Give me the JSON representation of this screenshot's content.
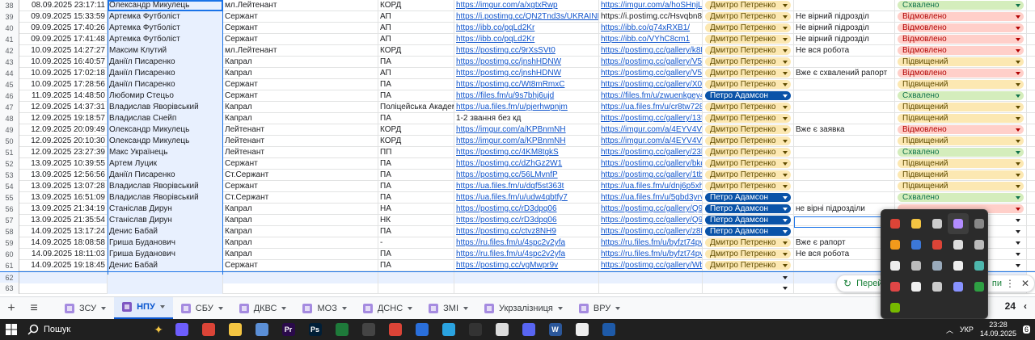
{
  "rows": [
    {
      "num": "38",
      "date": "08.09.2025 23:17:11",
      "name": "Олександр Микулець",
      "rank": "мл.Лейтенант",
      "unit": "КОРД",
      "link1": "https://imgur.com/a/xgtxRwp",
      "link2": "https://imgur.com/a/hoSHnjL",
      "reviewer": "Дмитро Петренко",
      "reviewer_style": "yellow",
      "note": "",
      "status": "Схвалено",
      "status_style": "green"
    },
    {
      "num": "39",
      "date": "09.09.2025 15:33:59",
      "name": "Артемка Футболіст",
      "rank": "Сержант",
      "unit": "АП",
      "link1": "https://i.postimg.cc/QN2Tnd3s/UKRAINE-GT",
      "link2": "https://i.postimg.cc/Hsvqbn80/U",
      "reviewer": "Дмитро Петренко",
      "reviewer_style": "yellow",
      "note": "Не вірний підрозділ",
      "status": "Відмовлено",
      "status_style": "red",
      "link2_plain": true
    },
    {
      "num": "40",
      "date": "09.09.2025 17:40:26",
      "name": "Артемка Футболіст",
      "rank": "Сержант",
      "unit": "АП",
      "link1": "https://ibb.co/pqLd2Kr",
      "link2": "https://ibb.co/q74xRXB1/",
      "reviewer": "Дмитро Петренко",
      "reviewer_style": "yellow",
      "note": "Не вірний підрозділ",
      "status": "Відмовлено",
      "status_style": "red"
    },
    {
      "num": "41",
      "date": "09.09.2025 17:41:48",
      "name": "Артемка Футболіст",
      "rank": "Сержант",
      "unit": "АП",
      "link1": "https://ibb.co/pqLd2Kr",
      "link2": "https://ibb.co/VYhC8cm1",
      "reviewer": "Дмитро Петренко",
      "reviewer_style": "yellow",
      "note": "Не вірний підрозділ",
      "status": "Відмовлено",
      "status_style": "red"
    },
    {
      "num": "42",
      "date": "10.09.2025 14:27:27",
      "name": "Максим Клутий",
      "rank": "мл.Лейтенант",
      "unit": "КОРД",
      "link1": "https://postimg.cc/9rXsSVt0",
      "link2": "https://postimg.cc/gallery/k8M1l",
      "reviewer": "Дмитро Петренко",
      "reviewer_style": "yellow",
      "note": "Не вся робота",
      "status": "Відмовлено",
      "status_style": "red"
    },
    {
      "num": "43",
      "date": "10.09.2025 16:40:57",
      "name": "Даніїл Писаренко",
      "rank": "Капрал",
      "unit": "ПА",
      "link1": "https://postimg.cc/jnshHDNW",
      "link2": "https://postimg.cc/gallery/V5Sf9",
      "reviewer": "Дмитро Петренко",
      "reviewer_style": "yellow",
      "note": "",
      "status": "Підвищений",
      "status_style": "yellow"
    },
    {
      "num": "44",
      "date": "10.09.2025 17:02:18",
      "name": "Даніїл Писаренко",
      "rank": "Капрал",
      "unit": "АП",
      "link1": "https://postimg.cc/jnshHDNW",
      "link2": "https://postimg.cc/gallery/V5Sf9",
      "reviewer": "Дмитро Петренко",
      "reviewer_style": "yellow",
      "note": "Вже є схвалений рапорт",
      "status": "Відмовлено",
      "status_style": "red"
    },
    {
      "num": "45",
      "date": "10.09.2025 17:28:56",
      "name": "Даніїл Писаренко",
      "rank": "Сержант",
      "unit": "ПА",
      "link1": "https://postimg.cc/Wt8mRmxC",
      "link2": "https://postimg.cc/gallery/X0J1",
      "reviewer": "Дмитро Петренко",
      "reviewer_style": "yellow",
      "note": "",
      "status": "Підвищений",
      "status_style": "yellow"
    },
    {
      "num": "46",
      "date": "11.09.2025 14:48:50",
      "name": "Любомир Стецьо",
      "rank": "Сержант",
      "unit": "ПА",
      "link1": "https://files.fm/u/9s7bhj6ujd",
      "link2": "https://files.fm/u/zwuenkgey4",
      "reviewer": "Петро Адамсон",
      "reviewer_style": "blue",
      "note": "",
      "status": "Схвалено",
      "status_style": "green"
    },
    {
      "num": "47",
      "date": "12.09.2025 14:37:31",
      "name": "Владислав Яворівський",
      "rank": "Капрал",
      "unit": "Поліцейська Академія",
      "link1": "https://ua.files.fm/u/pjerhwpnjm",
      "link2": "https://ua.files.fm/u/cr8tw728wf",
      "reviewer": "Дмитро Петренко",
      "reviewer_style": "yellow",
      "note": "",
      "status": "Підвищений",
      "status_style": "yellow"
    },
    {
      "num": "48",
      "date": "12.09.2025 19:18:57",
      "name": "Владислав Снейп",
      "rank": "Капрал",
      "unit": "ПА",
      "link1": "1-2 звання без кд",
      "link1_plain": true,
      "link2": "https://postimg.cc/gallery/13fN7",
      "reviewer": "Дмитро Петренко",
      "reviewer_style": "yellow",
      "note": "",
      "status": "Підвищений",
      "status_style": "yellow"
    },
    {
      "num": "49",
      "date": "12.09.2025 20:09:49",
      "name": "Олександр Микулець",
      "rank": "Лейтенант",
      "unit": "КОРД",
      "link1": "https://imgur.com/a/KPBnmNH",
      "link2": "https://imgur.com/a/4EYV4VW",
      "reviewer": "Дмитро Петренко",
      "reviewer_style": "yellow",
      "note": "Вже є заявка",
      "status": "Відмовлено",
      "status_style": "red"
    },
    {
      "num": "50",
      "date": "12.09.2025 20:10:30",
      "name": "Олександр Микулець",
      "rank": "Лейтенант",
      "unit": "КОРД",
      "link1": "https://imgur.com/a/KPBnmNH",
      "link2": "https://imgur.com/a/4EYV4VW",
      "reviewer": "Дмитро Петренко",
      "reviewer_style": "yellow",
      "note": "",
      "status": "Підвищений",
      "status_style": "yellow"
    },
    {
      "num": "51",
      "date": "12.09.2025 23:27:39",
      "name": "Макс Українець",
      "rank": "Лейтенант",
      "unit": "ПП",
      "link1": "https://postimg.cc/4KM8tgkS",
      "link2": "https://postimg.cc/gallery/23bg4",
      "reviewer": "Дмитро Петренко",
      "reviewer_style": "yellow",
      "note": "",
      "status": "Схвалено",
      "status_style": "green"
    },
    {
      "num": "52",
      "date": "13.09.2025 10:39:55",
      "name": "Артем Луцик",
      "rank": "Сержант",
      "unit": "ПА",
      "link1": "https://postimg.cc/dZhGz2W1",
      "link2": "https://postimg.cc/gallery/bkdTh",
      "reviewer": "Дмитро Петренко",
      "reviewer_style": "yellow",
      "note": "",
      "status": "Підвищений",
      "status_style": "yellow"
    },
    {
      "num": "53",
      "date": "13.09.2025 12:56:56",
      "name": "Даніїл Писаренко",
      "rank": "Ст.Сержант",
      "unit": "ПА",
      "link1": "https://postimg.cc/56LMvnfP",
      "link2": "https://postimg.cc/gallery/1tbcK",
      "reviewer": "Дмитро Петренко",
      "reviewer_style": "yellow",
      "note": "",
      "status": "Підвищений",
      "status_style": "yellow"
    },
    {
      "num": "54",
      "date": "13.09.2025 13:07:28",
      "name": "Владислав Яворівський",
      "rank": "Сержант",
      "unit": "ПА",
      "link1": "https://ua.files.fm/u/dqf5st363t",
      "link2": "https://ua.files.fm/u/dnj6p5xhae",
      "reviewer": "Дмитро Петренко",
      "reviewer_style": "yellow",
      "note": "",
      "status": "Підвищений",
      "status_style": "yellow"
    },
    {
      "num": "55",
      "date": "13.09.2025 16:51:09",
      "name": "Владислав Яворівський",
      "rank": "Ст.Сержант",
      "unit": "ПА",
      "link1": "https://ua.files.fm/u/udw4qbtfy7",
      "link2": "https://ua.files.fm/u/5gbd3yrvtb",
      "reviewer": "Петро Адамсон",
      "reviewer_style": "blue",
      "note": "",
      "status": "Схвалено",
      "status_style": "green"
    },
    {
      "num": "56",
      "date": "13.09.2025 21:34:19",
      "name": "Станіслав Дирун",
      "rank": "Капрал",
      "unit": "НА",
      "link1": "https://postimg.cc/rD3dpq06",
      "link2": "https://postimg.cc/gallery/Q9ds",
      "reviewer": "Петро Адамсон",
      "reviewer_style": "blue",
      "note": "не вірні підрозділи",
      "status": "",
      "status_style": "red"
    },
    {
      "num": "57",
      "date": "13.09.2025 21:35:54",
      "name": "Станіслав Дирун",
      "rank": "Капрал",
      "unit": "НК",
      "link1": "https://postimg.cc/rD3dpq06",
      "link2": "https://postimg.cc/gallery/Q9ds",
      "reviewer": "Петро Адамсон",
      "reviewer_style": "blue",
      "note": "",
      "status": "",
      "status_style": "none"
    },
    {
      "num": "58",
      "date": "14.09.2025 13:17:24",
      "name": "Денис Бабай",
      "rank": "Капрал",
      "unit": "ПА",
      "link1": "https://postimg.cc/ctvz8NH9",
      "link2": "https://postimg.cc/gallery/z8Rv7",
      "reviewer": "Петро Адамсон",
      "reviewer_style": "blue",
      "note": "",
      "status": "",
      "status_style": "none"
    },
    {
      "num": "59",
      "date": "14.09.2025 18:08:58",
      "name": "Гриша Буданович",
      "rank": "Капрал",
      "unit": "-",
      "link1": "https://ru.files.fm/u/4spc2v2yfa",
      "link2": "https://ru.files.fm/u/byfzt74pvm",
      "reviewer": "Дмитро Петренко",
      "reviewer_style": "yellow",
      "note": "Вже є рапорт",
      "status": "",
      "status_style": "none"
    },
    {
      "num": "60",
      "date": "14.09.2025 18:11:03",
      "name": "Гриша Буданович",
      "rank": "Капрал",
      "unit": "ПА",
      "link1": "https://ru.files.fm/u/4spc2v2yfa",
      "link2": "https://ru.files.fm/u/byfzt74pvm",
      "reviewer": "Дмитро Петренко",
      "reviewer_style": "yellow",
      "note": "Не вся робота",
      "status": "",
      "status_style": "none"
    },
    {
      "num": "61",
      "date": "14.09.2025 19:18:45",
      "name": "Денис Бабай",
      "rank": "Сержант",
      "unit": "ПА",
      "link1": "https://postimg.cc/vgMwpr9v",
      "link2": "https://postimg.cc/gallery/WbQk",
      "reviewer": "Дмитро Петренко",
      "reviewer_style": "yellow",
      "note": "",
      "status": "",
      "status_style": "none"
    }
  ],
  "empty_rows": [
    "62",
    "63"
  ],
  "tabs": [
    {
      "label": "ЗСУ",
      "active": false
    },
    {
      "label": "НПУ",
      "active": true
    },
    {
      "label": "СБУ",
      "active": false
    },
    {
      "label": "ДКВС",
      "active": false
    },
    {
      "label": "МОЗ",
      "active": false
    },
    {
      "label": "ДСНС",
      "active": false
    },
    {
      "label": "ЗМІ",
      "active": false
    },
    {
      "label": "Укрзалізниця",
      "active": false
    },
    {
      "label": "ВРУ",
      "active": false
    }
  ],
  "tabbar": {
    "add": "+",
    "menu": "≡",
    "count": "24"
  },
  "explore": {
    "label": "Перей"
  },
  "taskbar": {
    "search_label": "Пошук",
    "lang": "УКР",
    "time": "23:28",
    "date": "14.09.2025",
    "notif": "6"
  },
  "colors": {
    "yellow_chip": "#fce8b2",
    "yellow_text": "#5f4b00",
    "blue_chip": "#0a53a8",
    "blue_text": "#ffffff",
    "green_chip": "#d4edbc",
    "green_text": "#11734b",
    "red_chip": "#ffcfc9",
    "red_text": "#b10202"
  }
}
